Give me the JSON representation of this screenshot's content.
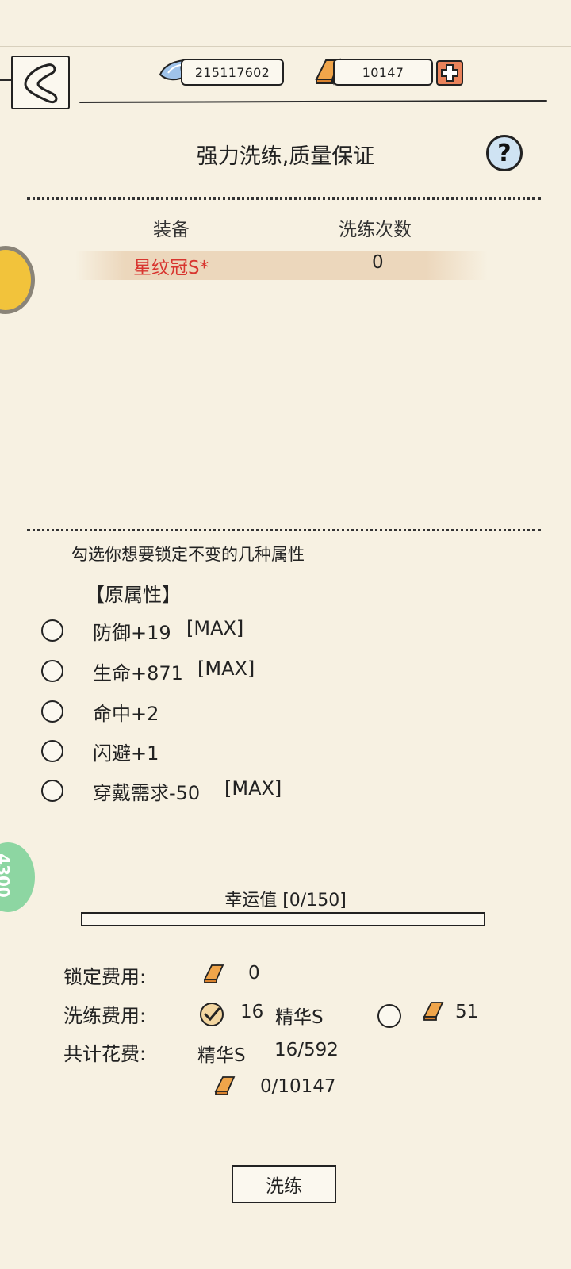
{
  "currency": {
    "silver": "215117602",
    "gold": "10147"
  },
  "title": "强力洗练,质量保证",
  "help_label": "?",
  "table": {
    "headers": [
      "装备",
      "洗练次数"
    ],
    "rows": [
      {
        "name": "星纹冠S*",
        "count": "0"
      }
    ]
  },
  "lock_hint": "勾选你想要锁定不变的几种属性",
  "attr_heading": "【原属性】",
  "attributes": [
    {
      "label": "防御+19",
      "tag": "[MAX]"
    },
    {
      "label": "生命+871",
      "tag": "[MAX]"
    },
    {
      "label": "命中+2",
      "tag": ""
    },
    {
      "label": "闪避+1",
      "tag": ""
    },
    {
      "label": "穿戴需求-50",
      "tag": "[MAX]"
    }
  ],
  "side_badge": "4300",
  "luck": {
    "label": "幸运值  [0/150]",
    "current": 0,
    "max": 150
  },
  "costs": {
    "lock_label": "锁定费用:",
    "lock_value": "0",
    "refine_label": "洗练费用:",
    "refine_essence_qty": "16",
    "refine_essence_name": "精华S",
    "refine_gold_value": "51",
    "total_label": "共计花费:",
    "total_essence_name": "精华S",
    "total_essence_value": "16/592",
    "total_gold_value": "0/10147"
  },
  "refine_button": "洗练",
  "colors": {
    "background": "#f7f1e2",
    "equip_name": "#d8352f",
    "plus_button": "#e9825a",
    "help_button": "#cfe3f3"
  }
}
